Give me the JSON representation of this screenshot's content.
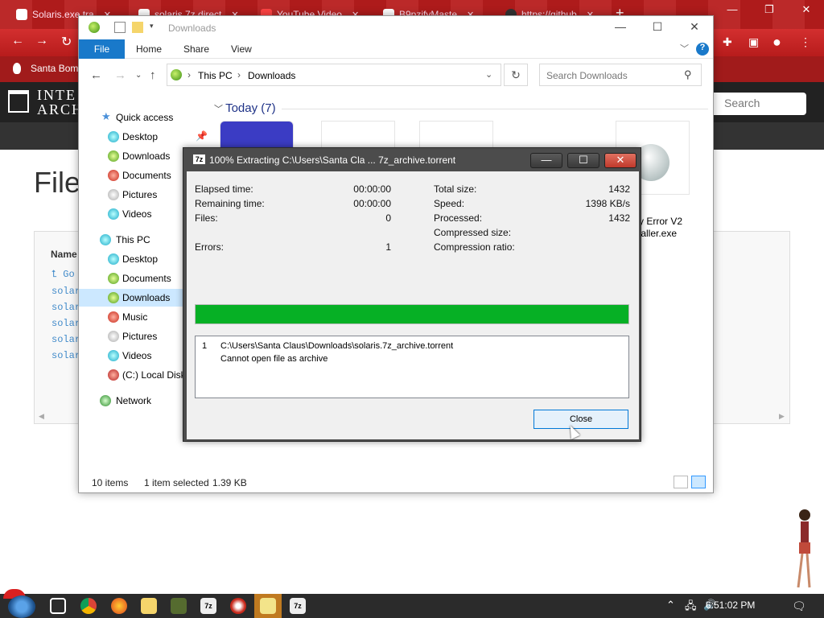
{
  "browser": {
    "tabs": [
      {
        "label": "Solaris.exe.tra"
      },
      {
        "label": "solaris.7z direct"
      },
      {
        "label": "YouTube Video"
      },
      {
        "label": "B9pzifyMaste"
      },
      {
        "label": "https://github"
      }
    ],
    "bookmark": "Santa Bom",
    "page": {
      "logo_line1": "INTE",
      "logo_line2": "ARCHI",
      "search_placeholder": "Search",
      "files_title": "File",
      "name_header": "Name",
      "go_up": "Go",
      "file_links": [
        "solar",
        "solar",
        "solar",
        "solar",
        "solar"
      ]
    }
  },
  "explorer": {
    "title": "Downloads",
    "ribbon": {
      "file": "File",
      "home": "Home",
      "share": "Share",
      "view": "View",
      "help": "?"
    },
    "address": {
      "this_pc": "This PC",
      "downloads": "Downloads"
    },
    "search_placeholder": "Search Downloads",
    "nav": {
      "quick_access": "Quick access",
      "qa_items": [
        "Desktop",
        "Downloads",
        "Documents",
        "Pictures",
        "Videos"
      ],
      "this_pc": "This PC",
      "pc_items": [
        "Desktop",
        "Documents",
        "Downloads",
        "Music",
        "Pictures",
        "Videos",
        "(C:) Local Disk"
      ],
      "network": "Network"
    },
    "group_header": "Today (7)",
    "visible_file_label_line1": "zy Error V2",
    "visible_file_label_line2": "taller.exe",
    "status": {
      "items": "10 items",
      "selected": "1 item selected",
      "size": "1.39 KB"
    }
  },
  "sevenzip": {
    "title": "100% Extracting C:\\Users\\Santa Cla ... 7z_archive.torrent",
    "progress_percent": 100,
    "left_stats": [
      {
        "label": "Elapsed time:",
        "value": "00:00:00"
      },
      {
        "label": "Remaining time:",
        "value": "00:00:00"
      },
      {
        "label": "Files:",
        "value": "0"
      },
      {
        "label": "Errors:",
        "value": "1"
      }
    ],
    "right_stats": [
      {
        "label": "Total size:",
        "value": "1432"
      },
      {
        "label": "Speed:",
        "value": "1398 KB/s"
      },
      {
        "label": "Processed:",
        "value": "1432"
      },
      {
        "label": "Compressed size:",
        "value": ""
      },
      {
        "label": "Compression ratio:",
        "value": ""
      }
    ],
    "messages": [
      {
        "num": "1",
        "path": "C:\\Users\\Santa Claus\\Downloads\\solaris.7z_archive.torrent",
        "error": "Cannot open file as archive"
      }
    ],
    "close_label": "Close"
  },
  "taskbar": {
    "clock": "6:51:02 PM"
  },
  "colors": {
    "browser_red": "#b71c1c",
    "ribbon_file_blue": "#1979ca",
    "progress_green": "#06b025",
    "selected_nav": "#cce8ff"
  }
}
